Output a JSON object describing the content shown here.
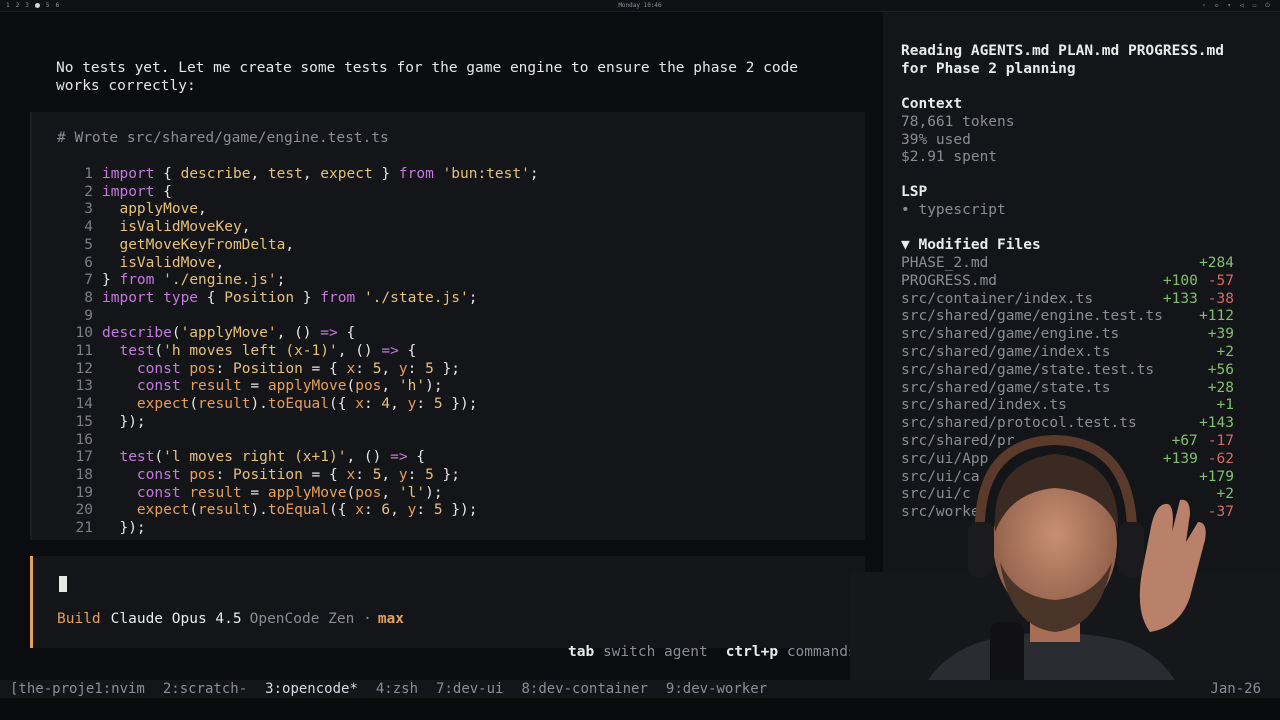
{
  "topbar": {
    "workspaces": [
      "1",
      "2",
      "3",
      "",
      "5",
      "6"
    ],
    "clock": "Monday 10:46"
  },
  "conversation": {
    "message": "No tests yet. Let me create some tests for the game engine to ensure the phase 2 code works correctly:",
    "code_title": "# Wrote src/shared/game/engine.test.ts",
    "code_lines": [
      {
        "n": "1",
        "parts": [
          [
            "kw",
            "import"
          ],
          [
            "pl",
            " { "
          ],
          [
            "tp",
            "describe"
          ],
          [
            "pl",
            ", "
          ],
          [
            "tp",
            "test"
          ],
          [
            "pl",
            ", "
          ],
          [
            "tp",
            "expect"
          ],
          [
            "pl",
            " } "
          ],
          [
            "kw",
            "from"
          ],
          [
            "pl",
            " "
          ],
          [
            "str",
            "'bun:test'"
          ],
          [
            "pl",
            ";"
          ]
        ]
      },
      {
        "n": "2",
        "parts": [
          [
            "kw",
            "import"
          ],
          [
            "pl",
            " {"
          ]
        ]
      },
      {
        "n": "3",
        "parts": [
          [
            "pl",
            "  "
          ],
          [
            "fn",
            "applyMove"
          ],
          [
            "pl",
            ","
          ]
        ]
      },
      {
        "n": "4",
        "parts": [
          [
            "pl",
            "  "
          ],
          [
            "fn",
            "isValidMoveKey"
          ],
          [
            "pl",
            ","
          ]
        ]
      },
      {
        "n": "5",
        "parts": [
          [
            "pl",
            "  "
          ],
          [
            "fn",
            "getMoveKeyFromDelta"
          ],
          [
            "pl",
            ","
          ]
        ]
      },
      {
        "n": "6",
        "parts": [
          [
            "pl",
            "  "
          ],
          [
            "fn",
            "isValidMove"
          ],
          [
            "pl",
            ","
          ]
        ]
      },
      {
        "n": "7",
        "parts": [
          [
            "pl",
            "} "
          ],
          [
            "kw",
            "from"
          ],
          [
            "pl",
            " "
          ],
          [
            "str",
            "'./engine.js'"
          ],
          [
            "pl",
            ";"
          ]
        ]
      },
      {
        "n": "8",
        "parts": [
          [
            "kw",
            "import type"
          ],
          [
            "pl",
            " { "
          ],
          [
            "tp",
            "Position"
          ],
          [
            "pl",
            " } "
          ],
          [
            "kw",
            "from"
          ],
          [
            "pl",
            " "
          ],
          [
            "str",
            "'./state.js'"
          ],
          [
            "pl",
            ";"
          ]
        ]
      },
      {
        "n": "9",
        "parts": []
      },
      {
        "n": "10",
        "parts": [
          [
            "kw",
            "describe"
          ],
          [
            "pl",
            "("
          ],
          [
            "str",
            "'applyMove'"
          ],
          [
            "pl",
            ", () "
          ],
          [
            "kw",
            "=>"
          ],
          [
            "pl",
            " {"
          ]
        ]
      },
      {
        "n": "11",
        "parts": [
          [
            "pl",
            "  "
          ],
          [
            "kw",
            "test"
          ],
          [
            "pl",
            "("
          ],
          [
            "str",
            "'h moves left (x-1)'"
          ],
          [
            "pl",
            ", () "
          ],
          [
            "kw",
            "=>"
          ],
          [
            "pl",
            " {"
          ]
        ]
      },
      {
        "n": "12",
        "parts": [
          [
            "pl",
            "    "
          ],
          [
            "kw",
            "const"
          ],
          [
            "pl",
            " "
          ],
          [
            "mt",
            "pos"
          ],
          [
            "pl",
            ": "
          ],
          [
            "tp",
            "Position"
          ],
          [
            "pl",
            " = { "
          ],
          [
            "mt",
            "x"
          ],
          [
            "pl",
            ": "
          ],
          [
            "num",
            "5"
          ],
          [
            "pl",
            ", "
          ],
          [
            "mt",
            "y"
          ],
          [
            "pl",
            ": "
          ],
          [
            "num",
            "5"
          ],
          [
            "pl",
            " };"
          ]
        ]
      },
      {
        "n": "13",
        "parts": [
          [
            "pl",
            "    "
          ],
          [
            "kw",
            "const"
          ],
          [
            "pl",
            " "
          ],
          [
            "mt",
            "result"
          ],
          [
            "pl",
            " = "
          ],
          [
            "mt",
            "applyMove"
          ],
          [
            "pl",
            "("
          ],
          [
            "mt",
            "pos"
          ],
          [
            "pl",
            ", "
          ],
          [
            "str",
            "'h'"
          ],
          [
            "pl",
            ");"
          ]
        ]
      },
      {
        "n": "14",
        "parts": [
          [
            "pl",
            "    "
          ],
          [
            "mt",
            "expect"
          ],
          [
            "pl",
            "("
          ],
          [
            "mt",
            "result"
          ],
          [
            "pl",
            ")."
          ],
          [
            "mt",
            "toEqual"
          ],
          [
            "pl",
            "({ "
          ],
          [
            "mt",
            "x"
          ],
          [
            "pl",
            ": "
          ],
          [
            "num",
            "4"
          ],
          [
            "pl",
            ", "
          ],
          [
            "mt",
            "y"
          ],
          [
            "pl",
            ": "
          ],
          [
            "num",
            "5"
          ],
          [
            "pl",
            " });"
          ]
        ]
      },
      {
        "n": "15",
        "parts": [
          [
            "pl",
            "  });"
          ]
        ]
      },
      {
        "n": "16",
        "parts": []
      },
      {
        "n": "17",
        "parts": [
          [
            "pl",
            "  "
          ],
          [
            "kw",
            "test"
          ],
          [
            "pl",
            "("
          ],
          [
            "str",
            "'l moves right (x+1)'"
          ],
          [
            "pl",
            ", () "
          ],
          [
            "kw",
            "=>"
          ],
          [
            "pl",
            " {"
          ]
        ]
      },
      {
        "n": "18",
        "parts": [
          [
            "pl",
            "    "
          ],
          [
            "kw",
            "const"
          ],
          [
            "pl",
            " "
          ],
          [
            "mt",
            "pos"
          ],
          [
            "pl",
            ": "
          ],
          [
            "tp",
            "Position"
          ],
          [
            "pl",
            " = { "
          ],
          [
            "mt",
            "x"
          ],
          [
            "pl",
            ": "
          ],
          [
            "num",
            "5"
          ],
          [
            "pl",
            ", "
          ],
          [
            "mt",
            "y"
          ],
          [
            "pl",
            ": "
          ],
          [
            "num",
            "5"
          ],
          [
            "pl",
            " };"
          ]
        ]
      },
      {
        "n": "19",
        "parts": [
          [
            "pl",
            "    "
          ],
          [
            "kw",
            "const"
          ],
          [
            "pl",
            " "
          ],
          [
            "mt",
            "result"
          ],
          [
            "pl",
            " = "
          ],
          [
            "mt",
            "applyMove"
          ],
          [
            "pl",
            "("
          ],
          [
            "mt",
            "pos"
          ],
          [
            "pl",
            ", "
          ],
          [
            "str",
            "'l'"
          ],
          [
            "pl",
            ");"
          ]
        ]
      },
      {
        "n": "20",
        "parts": [
          [
            "pl",
            "    "
          ],
          [
            "mt",
            "expect"
          ],
          [
            "pl",
            "("
          ],
          [
            "mt",
            "result"
          ],
          [
            "pl",
            ")."
          ],
          [
            "mt",
            "toEqual"
          ],
          [
            "pl",
            "({ "
          ],
          [
            "mt",
            "x"
          ],
          [
            "pl",
            ": "
          ],
          [
            "num",
            "6"
          ],
          [
            "pl",
            ", "
          ],
          [
            "mt",
            "y"
          ],
          [
            "pl",
            ": "
          ],
          [
            "num",
            "5"
          ],
          [
            "pl",
            " });"
          ]
        ]
      },
      {
        "n": "21",
        "parts": [
          [
            "pl",
            "  });"
          ]
        ]
      }
    ]
  },
  "input": {
    "mode": "Build",
    "model": "Claude Opus 4.5",
    "provider": "OpenCode Zen ·",
    "level": "max"
  },
  "hints": [
    {
      "key": "tab",
      "label": "switch agent"
    },
    {
      "key": "ctrl+p",
      "label": "commands"
    }
  ],
  "sidebar": {
    "title": "Reading AGENTS.md PLAN.md PROGRESS.md for Phase 2 planning",
    "context": {
      "heading": "Context",
      "tokens": "78,661 tokens",
      "used": "39% used",
      "spent": "$2.91 spent"
    },
    "lsp": {
      "heading": "LSP",
      "item": "• typescript"
    },
    "modified": {
      "heading": "▼ Modified Files",
      "files": [
        {
          "name": "PHASE_2.md",
          "add": "+284",
          "del": ""
        },
        {
          "name": "PROGRESS.md",
          "add": "+100",
          "del": "-57"
        },
        {
          "name": "src/container/index.ts",
          "add": "+133",
          "del": "-38"
        },
        {
          "name": "src/shared/game/engine.test.ts",
          "add": "+112",
          "del": ""
        },
        {
          "name": "src/shared/game/engine.ts",
          "add": "+39",
          "del": ""
        },
        {
          "name": "src/shared/game/index.ts",
          "add": "+2",
          "del": ""
        },
        {
          "name": "src/shared/game/state.test.ts",
          "add": "+56",
          "del": ""
        },
        {
          "name": "src/shared/game/state.ts",
          "add": "+28",
          "del": ""
        },
        {
          "name": "src/shared/index.ts",
          "add": "+1",
          "del": ""
        },
        {
          "name": "src/shared/protocol.test.ts",
          "add": "+143",
          "del": ""
        },
        {
          "name": "src/shared/pr",
          "add": "+67",
          "del": "-17"
        },
        {
          "name": "src/ui/App",
          "add": "+139",
          "del": "-62"
        },
        {
          "name": "src/ui/ca",
          "add": "+179",
          "del": ""
        },
        {
          "name": "src/ui/c",
          "add": "+2",
          "del": ""
        },
        {
          "name": "src/worke",
          "add": "",
          "del": "-37"
        }
      ]
    }
  },
  "tmux": {
    "windows": [
      "[the-proje1:nvim",
      "2:scratch-",
      "3:opencode*",
      "4:zsh",
      "7:dev-ui",
      "8:dev-container",
      "9:dev-worker"
    ],
    "right": "Jan-26"
  },
  "colors": {
    "accent": "#e4a05c",
    "keyword": "#c678dd",
    "added": "#7ec16e",
    "removed": "#d46a5f"
  }
}
